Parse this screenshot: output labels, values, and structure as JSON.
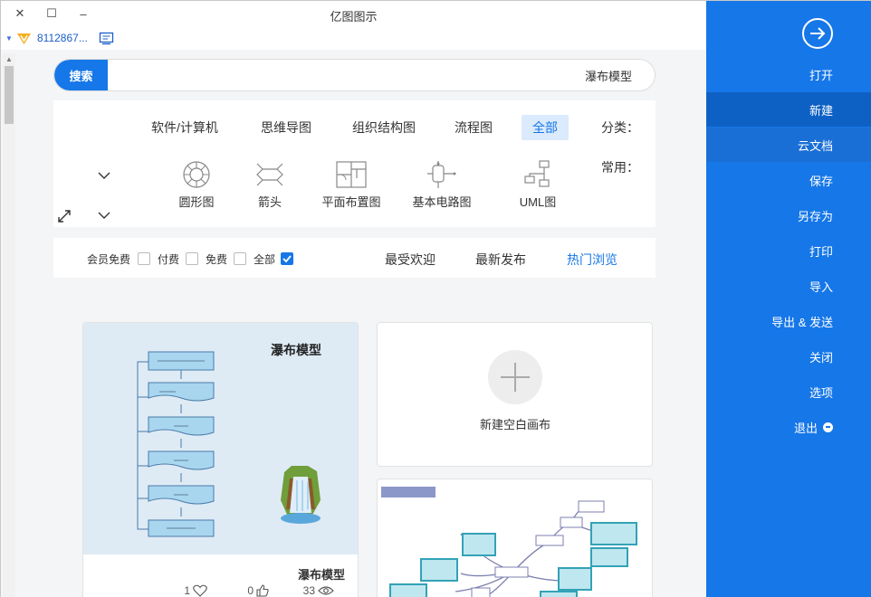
{
  "window": {
    "title": "亿图图示",
    "close_glyph": "✕",
    "restore_glyph": "☐",
    "minimize_glyph": "–"
  },
  "user": {
    "id": "8112867...",
    "caret_glyph": "▼"
  },
  "search": {
    "button_label": "搜索",
    "value": "瀑布模型"
  },
  "filters": {
    "category_label": "分类：",
    "categories": [
      "全部",
      "流程图",
      "组织结构图",
      "思维导图",
      "软件/计算机"
    ],
    "active_category": "全部",
    "common_label": "常用：",
    "common_items": [
      "UML图",
      "基本电路图",
      "平面布置图",
      "箭头",
      "圆形图"
    ]
  },
  "sort": {
    "options": [
      "热门浏览",
      "最新发布",
      "最受欢迎"
    ],
    "active": "热门浏览",
    "checkboxes": [
      {
        "label": "全部",
        "checked": true
      },
      {
        "label": "免费",
        "checked": false
      },
      {
        "label": "付费",
        "checked": false
      },
      {
        "label": "会员免费",
        "checked": false
      }
    ]
  },
  "cards": {
    "new_blank": {
      "label": "新建空白画布"
    },
    "template": {
      "title": "瀑布模型",
      "title_on_preview": "瀑布模型",
      "views": "33",
      "likes": "0",
      "favorites": "1"
    }
  },
  "sidebar": {
    "items": [
      "打开",
      "新建",
      "云文档",
      "保存",
      "另存为",
      "打印",
      "导入",
      "导出 & 发送",
      "关闭",
      "选项",
      "退出"
    ],
    "active": "新建",
    "highlighted": "云文档"
  },
  "colors": {
    "accent": "#1677e8",
    "sidebar_active": "#0e61c4"
  }
}
